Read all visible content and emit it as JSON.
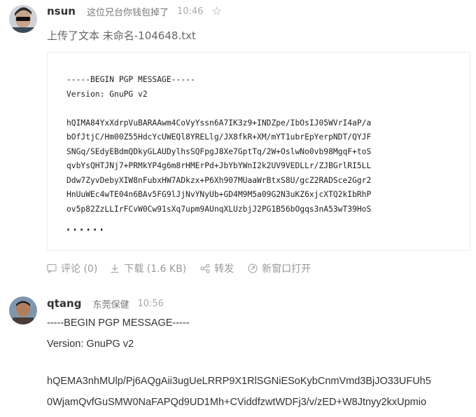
{
  "post1": {
    "username": "nsun",
    "group": "这位兄台你钱包掉了",
    "time": "10:46",
    "star_icon": "☆",
    "upload_note": "上传了文本 未命名-104648.txt",
    "file_lines": [
      "-----BEGIN PGP MESSAGE-----",
      "Version: GnuPG v2",
      "",
      "hQIMA84YxXdrpVuBARAAwm4CoVyYssn6A7IK3z9+INDZpe/IbOsIJ05WVrI4aP/a",
      "bOfJtjC/Hm00Z55HdcYcUWEQl8YRELlg/JX8fkR+XM/mYT1ubrEpYerpNDT/QYJF",
      "SNGq/SEdyEBdmQDkyGLAUDylhsSQFpgJ8Xe7GptTq/2W+OslwNo0vb98MgqF+toS",
      "qvbYsQHTJNj7+PRMkYP4g6m8rHMErPd+JbYbYWnI2k2UV9VEDLLr/ZJBGrlRI5LL",
      "Ddw7ZyvDebyXIW8nFubxHW7ADkzx+P6Xh907MUaaWrBtxS8U/gcZ2RADSce2Ggr2",
      "HnUuWEc4wTE04n6BAv5FG9lJjNvYNyUb+GD4M9M5a09G2N3uKZ6xjcXTQ2kIbRhP",
      "ov5p82ZzLLIrFCvW0Cw91sXq7upm9AUnqXLUzbjJ2PG1B56bOgqs3nA53wT39HoS"
    ],
    "ellipsis": "......",
    "actions": {
      "comment": "评论 (0)",
      "download": "下载 (1.6 KB)",
      "share": "转发",
      "open": "新窗口打开"
    }
  },
  "post2": {
    "username": "qtang",
    "group": "东莞保健",
    "time": "10:56",
    "lines": [
      "-----BEGIN PGP MESSAGE-----",
      "Version: GnuPG v2",
      "hQEMA3nhMUlp/Pj6AQgAii3ugUeLRRP9X1RlSGNiESoKybCnmVmd3BjJO33UFUh5",
      "0WjamQvfGuSMW0NaFAPQd9UD1Mh+CViddfzwtWDFj3/v/zED+W8Jtnyy2kxUpmio"
    ]
  }
}
